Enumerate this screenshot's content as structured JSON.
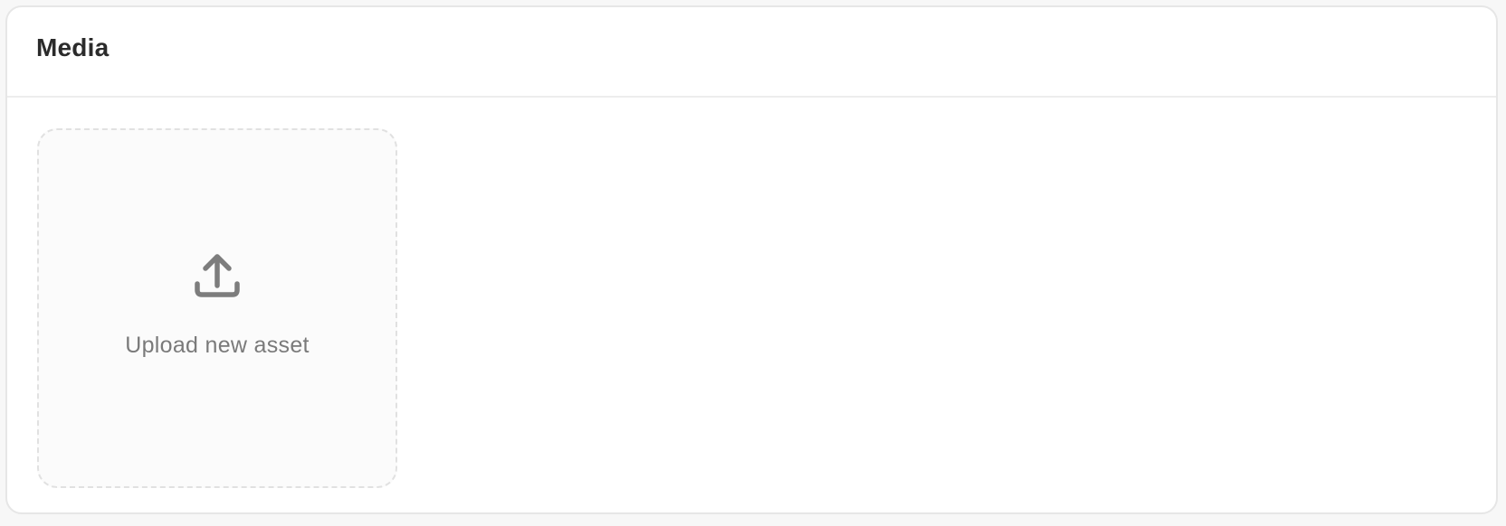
{
  "media_card": {
    "title": "Media",
    "upload_tile": {
      "icon": "upload-icon",
      "label": "Upload new asset"
    }
  },
  "colors": {
    "title_text": "#2b2b2b",
    "muted_text": "#7a7a7a",
    "icon": "#7d7d7d",
    "border": "#e6e6e6",
    "dashed_border": "#e1e1e1",
    "tile_background": "#fbfbfb",
    "page_background": "#f7f7f7"
  }
}
